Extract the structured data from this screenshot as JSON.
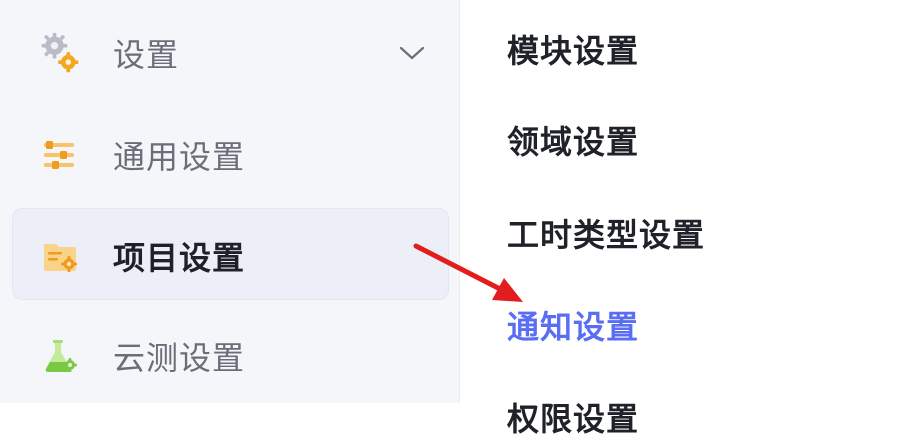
{
  "sidebar": {
    "group": {
      "label": "设置",
      "icon": "gear-cluster-icon",
      "chevron": "chevron-down-icon"
    },
    "items": [
      {
        "label": "通用设置",
        "icon": "sliders-icon",
        "active": false
      },
      {
        "label": "项目设置",
        "icon": "folder-gear-icon",
        "active": true
      },
      {
        "label": "云测设置",
        "icon": "flask-gear-icon",
        "active": false
      }
    ]
  },
  "settings_list": {
    "items": [
      {
        "label": "模块设置"
      },
      {
        "label": "领域设置"
      },
      {
        "label": "工时类型设置"
      },
      {
        "label": "通知设置"
      },
      {
        "label": "权限设置"
      }
    ],
    "highlighted_item": "通知设置"
  },
  "annotation": {
    "type": "red-arrow",
    "color": "#e21d1d"
  },
  "colors": {
    "accent": "#5a6ef4",
    "sidebar_bg": "#f5f6fa",
    "active_bg": "#eceef8",
    "icon_orange": "#f5a623",
    "icon_green": "#7ac943"
  }
}
